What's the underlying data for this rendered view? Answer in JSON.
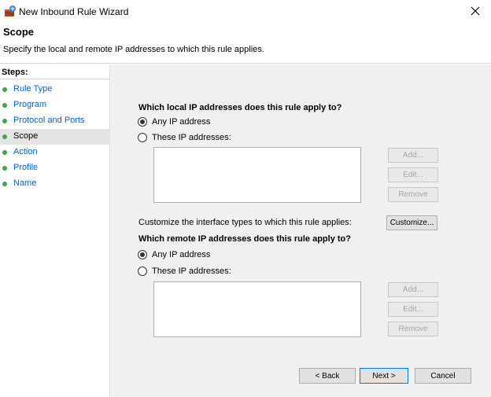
{
  "window": {
    "title": "New Inbound Rule Wizard"
  },
  "header": {
    "title": "Scope",
    "subtitle": "Specify the local and remote IP addresses to which this rule applies."
  },
  "steps": {
    "label": "Steps:",
    "items": [
      {
        "label": "Rule Type",
        "active": false
      },
      {
        "label": "Program",
        "active": false
      },
      {
        "label": "Protocol and Ports",
        "active": false
      },
      {
        "label": "Scope",
        "active": true
      },
      {
        "label": "Action",
        "active": false
      },
      {
        "label": "Profile",
        "active": false
      },
      {
        "label": "Name",
        "active": false
      }
    ]
  },
  "local": {
    "question": "Which local IP addresses does this rule apply to?",
    "any_label": "Any IP address",
    "these_label": "These IP addresses:",
    "selected": "any",
    "add_label": "Add...",
    "edit_label": "Edit...",
    "remove_label": "Remove"
  },
  "interfaces": {
    "text": "Customize the interface types to which this rule applies:",
    "button_label": "Customize..."
  },
  "remote": {
    "question": "Which remote IP addresses does this rule apply to?",
    "any_label": "Any IP address",
    "these_label": "These IP addresses:",
    "selected": "any",
    "add_label": "Add...",
    "edit_label": "Edit...",
    "remove_label": "Remove"
  },
  "footer": {
    "back_label": "< Back",
    "next_label": "Next >",
    "cancel_label": "Cancel"
  },
  "colors": {
    "step_link": "#0066cc",
    "step_dot": "#3cab3c",
    "primary_border": "#0078d7"
  },
  "icons": {
    "app": "firewall-wizard-icon",
    "close": "close-icon"
  }
}
